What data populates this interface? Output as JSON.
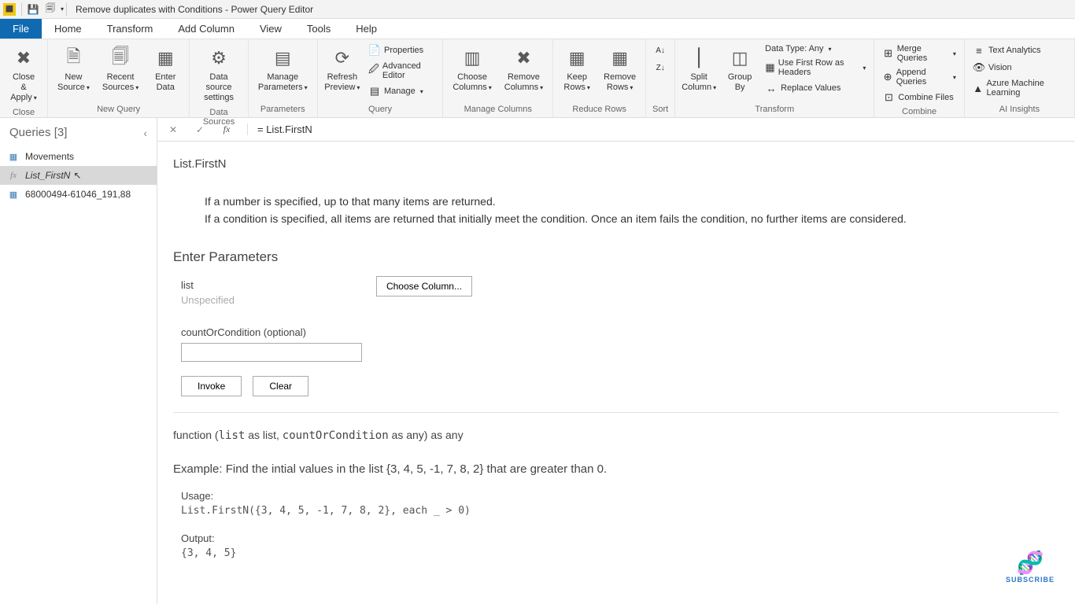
{
  "titlebar": {
    "title": "Remove duplicates with Conditions - Power Query Editor"
  },
  "menu": {
    "file": "File",
    "tabs": [
      "Home",
      "Transform",
      "Add Column",
      "View",
      "Tools",
      "Help"
    ]
  },
  "ribbon": {
    "close": {
      "closeApply": "Close &\nApply",
      "group": "Close"
    },
    "newquery": {
      "newSource": "New\nSource",
      "recentSources": "Recent\nSources",
      "enterData": "Enter\nData",
      "group": "New Query"
    },
    "datasources": {
      "settings": "Data source\nsettings",
      "group": "Data Sources"
    },
    "parameters": {
      "manage": "Manage\nParameters",
      "group": "Parameters"
    },
    "query": {
      "refresh": "Refresh\nPreview",
      "properties": "Properties",
      "advEditor": "Advanced Editor",
      "manage": "Manage",
      "group": "Query"
    },
    "manageCols": {
      "choose": "Choose\nColumns",
      "remove": "Remove\nColumns",
      "group": "Manage Columns"
    },
    "reduceRows": {
      "keep": "Keep\nRows",
      "remove": "Remove\nRows",
      "group": "Reduce Rows"
    },
    "sort": {
      "group": "Sort"
    },
    "transform": {
      "split": "Split\nColumn",
      "groupBy": "Group\nBy",
      "dataType": "Data Type: Any",
      "firstRow": "Use First Row as Headers",
      "replace": "Replace Values",
      "group": "Transform"
    },
    "combine": {
      "merge": "Merge Queries",
      "append": "Append Queries",
      "combineFiles": "Combine Files",
      "group": "Combine"
    },
    "ai": {
      "textAnalytics": "Text Analytics",
      "vision": "Vision",
      "azureML": "Azure Machine Learning",
      "group": "AI Insights"
    }
  },
  "queries": {
    "header": "Queries [3]",
    "items": [
      {
        "name": "Movements",
        "type": "table"
      },
      {
        "name": "List_FirstN",
        "type": "fx"
      },
      {
        "name": "68000494-61046_191,88",
        "type": "table"
      }
    ]
  },
  "formula": {
    "expression": "= List.FirstN"
  },
  "doc": {
    "fnName": "List.FirstN",
    "desc1": "If a number is specified, up to that many items are returned.",
    "desc2": "If a condition is specified, all items are returned that initially meet the condition. Once an item fails the condition, no further items are considered.",
    "enterParams": "Enter Parameters",
    "paramList": "list",
    "unspecified": "Unspecified",
    "chooseCol": "Choose Column...",
    "paramCond": "countOrCondition (optional)",
    "invoke": "Invoke",
    "clear": "Clear",
    "sigPrefix": "function (",
    "sigList": "list",
    "sigAsList": " as list, ",
    "sigCond": "countOrCondition",
    "sigSuffix": " as any) as any",
    "exampleH": "Example: Find the intial values in the list {3, 4, 5, -1, 7, 8, 2} that are greater than 0.",
    "usage": "Usage:",
    "usageCode": "List.FirstN({3, 4, 5, -1, 7, 8, 2}, each _ > 0)",
    "output": "Output:",
    "outputCode": "{3, 4, 5}"
  },
  "subscribe": "SUBSCRIBE"
}
